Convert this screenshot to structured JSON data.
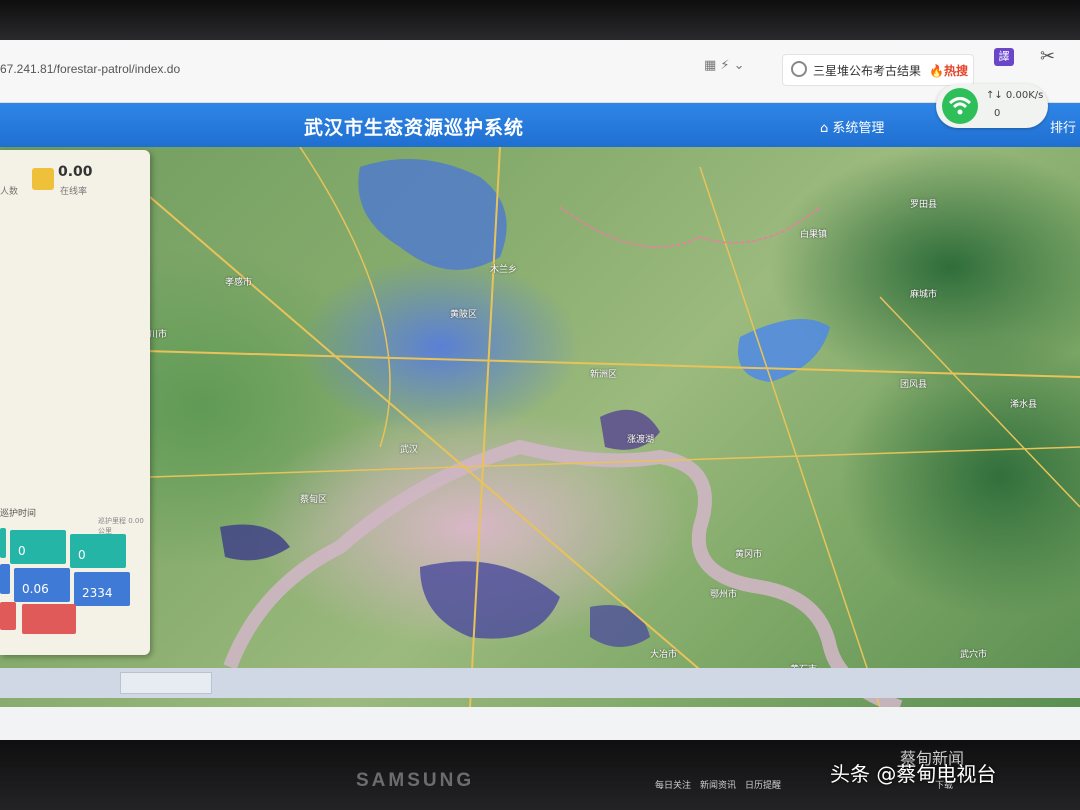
{
  "browser": {
    "url": "67.241.81/forestar-patrol/index.do",
    "search_text": "三星堆公布考古结果",
    "hot_label": "🔥热搜",
    "ext_label": "譯"
  },
  "app": {
    "title": "武汉市生态资源巡护系统",
    "nav_system": "系统管理",
    "nav_rank": "排行"
  },
  "network": {
    "speed": "↑↓ 0.00K/s",
    "count": "0"
  },
  "panel": {
    "online_value": "0.00",
    "online_label": "在线率",
    "inbound_label": "人数",
    "section_label": "巡护时间",
    "section_note": "巡护里程 0.00公里",
    "tiles": [
      {
        "label": "",
        "value": ""
      },
      {
        "label": "",
        "value": "0"
      },
      {
        "label": "",
        "value": "0"
      },
      {
        "label": "",
        "value": ""
      },
      {
        "label": "",
        "value": "0.06"
      },
      {
        "label": "",
        "value": "2334"
      },
      {
        "label": "",
        "value": ""
      },
      {
        "label": "",
        "value": ""
      }
    ]
  },
  "map_places": [
    {
      "name": "孝感市"
    },
    {
      "name": "黄陂区"
    },
    {
      "name": "新洲区"
    },
    {
      "name": "武汉"
    },
    {
      "name": "鄂州市"
    },
    {
      "name": "黄冈市"
    },
    {
      "name": "黄石市"
    },
    {
      "name": "汉川市"
    },
    {
      "name": "白果镇"
    },
    {
      "name": "麻城市"
    },
    {
      "name": "涨渡湖"
    },
    {
      "name": "团风县"
    },
    {
      "name": "浠水县"
    },
    {
      "name": "木兰乡"
    },
    {
      "name": "蔡甸区"
    },
    {
      "name": "大冶市"
    },
    {
      "name": "武穴市"
    },
    {
      "name": "罗田县"
    }
  ],
  "taskbar": {
    "items": [
      "每日关注",
      "新闻资讯",
      "日历提醒",
      "下载"
    ]
  },
  "monitor": {
    "brand": "SAMSUNG",
    "watermark": "头条 @蔡甸电视台",
    "wechat": "蔡甸新闻"
  }
}
